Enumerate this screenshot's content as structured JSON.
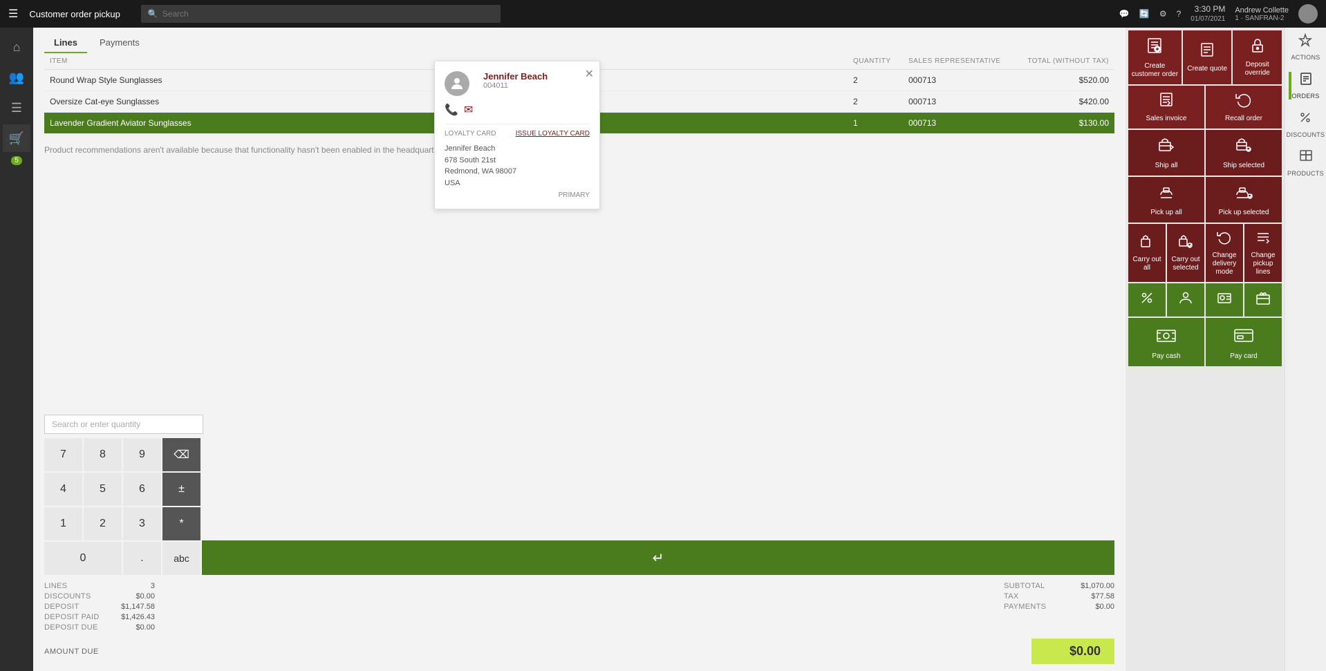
{
  "topbar": {
    "hamburger_icon": "☰",
    "title": "Customer order pickup",
    "search_placeholder": "Search",
    "time": "3:30 PM",
    "date": "01/07/2021",
    "store": "1 · SANFRAN-2",
    "user": "Andrew Collette"
  },
  "sidebar": {
    "items": [
      {
        "icon": "⌂",
        "label": "Home"
      },
      {
        "icon": "👥",
        "label": "Customers"
      },
      {
        "icon": "☰",
        "label": "Menu"
      },
      {
        "icon": "🛒",
        "label": "Cart",
        "active": true
      },
      {
        "icon": "5",
        "label": "5",
        "badge": true
      }
    ]
  },
  "tabs": [
    {
      "label": "Lines",
      "active": true
    },
    {
      "label": "Payments"
    }
  ],
  "table": {
    "headers": [
      "ITEM",
      "QUANTITY",
      "SALES REPRESENTATIVE",
      "TOTAL (WITHOUT TAX)"
    ],
    "rows": [
      {
        "item": "Round Wrap Style Sunglasses",
        "qty": "2",
        "rep": "000713",
        "total": "$520.00",
        "selected": false
      },
      {
        "item": "Oversize Cat-eye Sunglasses",
        "qty": "2",
        "rep": "000713",
        "total": "$420.00",
        "selected": false
      },
      {
        "item": "Lavender Gradient Aviator Sunglasses",
        "qty": "1",
        "rep": "000713",
        "total": "$130.00",
        "selected": true
      }
    ]
  },
  "recommendation_text": "Product recommendations aren't available because that functionality hasn't been enabled in the headquarters.",
  "numpad": {
    "search_placeholder": "Search or enter quantity",
    "keys": [
      [
        "7",
        "8",
        "9",
        "⌫"
      ],
      [
        "4",
        "5",
        "6",
        "±"
      ],
      [
        "1",
        "2",
        "3",
        "*"
      ]
    ],
    "bottom": [
      "0",
      ".",
      "abc"
    ],
    "enter_label": "↵"
  },
  "financials": {
    "lines_label": "LINES",
    "lines_value": "3",
    "discounts_label": "DISCOUNTS",
    "discounts_value": "$0.00",
    "deposit_label": "DEPOSIT",
    "deposit_value": "$1,147.58",
    "deposit_paid_label": "DEPOSIT PAID",
    "deposit_paid_value": "$1,426.43",
    "deposit_due_label": "DEPOSIT DUE",
    "deposit_due_value": "$0.00",
    "subtotal_label": "SUBTOTAL",
    "subtotal_value": "$1,070.00",
    "tax_label": "TAX",
    "tax_value": "$77.58",
    "payments_label": "PAYMENTS",
    "payments_value": "$0.00",
    "amount_due_label": "AMOUNT DUE",
    "amount_due_value": "$0.00"
  },
  "customer": {
    "name": "Jennifer Beach",
    "id": "004011",
    "address_line1": "678 South 21st",
    "address_line2": "Redmond, WA 98007",
    "address_line3": "USA",
    "loyalty_label": "LOYALTY CARD",
    "loyalty_action": "Issue loyalty card",
    "primary_label": "PRIMARY"
  },
  "action_tiles": {
    "rows": [
      [
        {
          "label": "Create customer order",
          "icon": "📋",
          "color": "dark-red",
          "colspan": 1
        },
        {
          "label": "Create quote",
          "icon": "📄",
          "color": "dark-red"
        },
        {
          "label": "Deposit override",
          "icon": "🔓",
          "color": "dark-red"
        }
      ],
      [
        {
          "label": "Ship all",
          "icon": "📦",
          "color": "medium-red"
        },
        {
          "label": "Ship selected",
          "icon": "📦",
          "color": "medium-red"
        }
      ],
      [
        {
          "label": "Pick up all",
          "icon": "🤲",
          "color": "medium-red"
        },
        {
          "label": "Pick up selected",
          "icon": "🤲",
          "color": "medium-red"
        }
      ],
      [
        {
          "label": "Carry out all",
          "icon": "🛍",
          "color": "medium-red"
        },
        {
          "label": "Carry out selected",
          "icon": "🛍",
          "color": "medium-red"
        },
        {
          "label": "Change delivery mode",
          "icon": "🔄",
          "color": "medium-red"
        },
        {
          "label": "Change pickup lines",
          "icon": "📝",
          "color": "medium-red"
        }
      ],
      [
        {
          "label": "",
          "icon": "➖",
          "color": "green"
        },
        {
          "label": "",
          "icon": "👤",
          "color": "green"
        },
        {
          "label": "",
          "icon": "🖼",
          "color": "green"
        },
        {
          "label": "",
          "icon": "💳",
          "color": "green"
        }
      ],
      [
        {
          "label": "Pay cash",
          "icon": "💵",
          "color": "green"
        },
        {
          "label": "Pay card",
          "icon": "💳",
          "color": "green"
        }
      ]
    ]
  },
  "side_toolbar": {
    "items": [
      {
        "label": "ACTIONS",
        "icon": "⚡"
      },
      {
        "label": "ORDERS",
        "icon": "📋"
      },
      {
        "label": "DISCOUNTS",
        "icon": "◇"
      },
      {
        "label": "PRODUCTS",
        "icon": "📦"
      }
    ]
  },
  "colors": {
    "dark_red": "#7a2020",
    "medium_red": "#6b1c1c",
    "green": "#4a7c1e",
    "accent_green": "#6aac1e",
    "selected_row": "#4a7c1e",
    "amount_bg": "#c8e84e"
  }
}
